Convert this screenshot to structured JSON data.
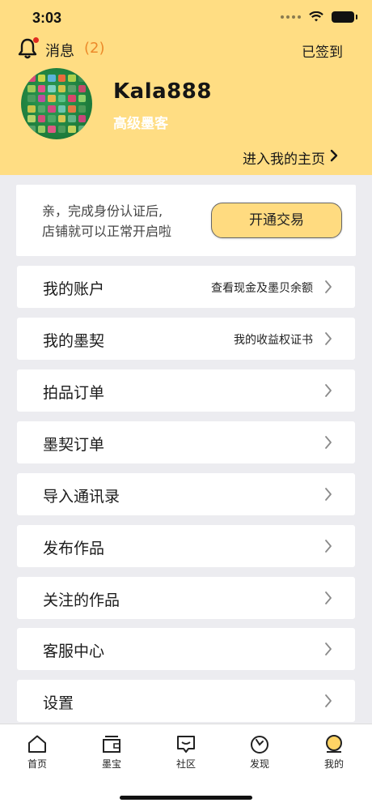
{
  "status_bar": {
    "time": "3:03"
  },
  "header": {
    "messages_label": "消息",
    "messages_count": "(2)",
    "checkin_label": "已签到",
    "username": "Kala888",
    "user_level": "高级墨客",
    "homepage_link": "进入我的主页"
  },
  "verify": {
    "line1": "亲，完成身份认证后,",
    "line2": "店铺就可以正常开启啦",
    "button": "开通交易"
  },
  "menu": [
    {
      "label": "我的账户",
      "sub": "查看现金及墨贝余额"
    },
    {
      "label": "我的墨契",
      "sub": "我的收益权证书"
    },
    {
      "label": "拍品订单",
      "sub": ""
    },
    {
      "label": "墨契订单",
      "sub": ""
    },
    {
      "label": "导入通讯录",
      "sub": ""
    },
    {
      "label": "发布作品",
      "sub": ""
    },
    {
      "label": "关注的作品",
      "sub": ""
    },
    {
      "label": "客服中心",
      "sub": ""
    },
    {
      "label": "设置",
      "sub": ""
    }
  ],
  "tabs": [
    {
      "label": "首页",
      "icon": "home-icon"
    },
    {
      "label": "墨宝",
      "icon": "wallet-icon"
    },
    {
      "label": "社区",
      "icon": "chat-icon"
    },
    {
      "label": "发现",
      "icon": "discover-icon"
    },
    {
      "label": "我的",
      "icon": "profile-icon",
      "active": true
    }
  ],
  "colors": {
    "header_bg": "#ffdd83",
    "accent_button": "#ffdb80",
    "message_count": "#ec8a2a",
    "notification_dot": "#e02b20",
    "page_bg": "#ececf0"
  }
}
